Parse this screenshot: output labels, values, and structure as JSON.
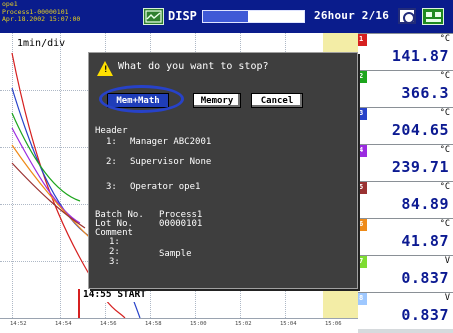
{
  "header": {
    "user": "ope1",
    "process": "Process1-00000101",
    "datetime": "Apr.18.2002 15:07:00",
    "mode_label": "DISP",
    "progress": 0.45,
    "time_span": "26hour 2/16",
    "icons": [
      "display-icon",
      "camera-icon",
      "key-icon"
    ]
  },
  "trend": {
    "scale_label": "1min/div",
    "time_ticks": [
      "14:52",
      "14:54",
      "14:56",
      "14:58",
      "15:00",
      "15:02",
      "15:04",
      "15:06"
    ],
    "start_marker": "14:55 START",
    "colors": {
      "red": "#d62020",
      "green": "#1da51d",
      "blue": "#2742c9",
      "purple": "#9b2be0",
      "brown": "#9a3232",
      "orange": "#ee8a18",
      "light_green": "#7fdc32",
      "light_blue": "#9ec8ff"
    }
  },
  "channels": [
    {
      "num": "1",
      "unit": "°C",
      "value": "141.87",
      "color": "#d62020"
    },
    {
      "num": "2",
      "unit": "°C",
      "value": "366.3",
      "color": "#1da51d"
    },
    {
      "num": "3",
      "unit": "°C",
      "value": "204.65",
      "color": "#2742c9"
    },
    {
      "num": "4",
      "unit": "°C",
      "value": "239.71",
      "color": "#9b2be0"
    },
    {
      "num": "5",
      "unit": "°C",
      "value": "84.89",
      "color": "#9a3232"
    },
    {
      "num": "6",
      "unit": "°C",
      "value": "41.87",
      "color": "#ee8a18"
    },
    {
      "num": "7",
      "unit": "V",
      "value": "0.837",
      "color": "#7fdc32"
    },
    {
      "num": "8",
      "unit": "V",
      "value": "0.837",
      "color": "#9ec8ff"
    }
  ],
  "dialog": {
    "question": "What do you want to stop?",
    "buttons": {
      "mem_math": "Mem+Math",
      "memory": "Memory",
      "cancel": "Cancel"
    },
    "header_label": "Header",
    "header_lines": [
      {
        "num": "1:",
        "text": "Manager ABC2001"
      },
      {
        "num": "2:",
        "text": "Supervisor None"
      },
      {
        "num": "3:",
        "text": "Operator ope1"
      }
    ],
    "batch_label": "Batch No.",
    "batch_value": "Process1",
    "lot_label": "Lot No.",
    "lot_value": "00000101",
    "comment_label": "Comment",
    "comment_lines": [
      {
        "num": "1:",
        "text": "Sample"
      },
      {
        "num": "2:",
        "text": ""
      },
      {
        "num": "3:",
        "text": ""
      }
    ]
  }
}
